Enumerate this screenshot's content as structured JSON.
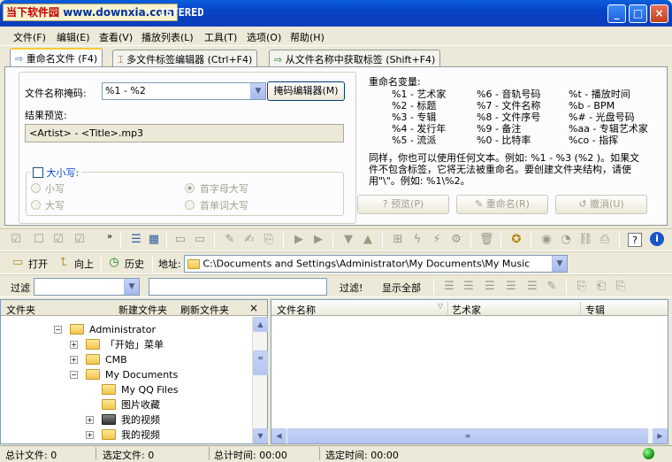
{
  "window": {
    "logo_part1": "当下软件园",
    "logo_part2": "www.downxia.com",
    "title": "ISTERED",
    "min": "_",
    "max": "□",
    "close": "×"
  },
  "menu": [
    "文件(F)",
    "编辑(E)",
    "查看(V)",
    "播放列表(L)",
    "工具(T)",
    "选项(O)",
    "帮助(H)"
  ],
  "tabs": [
    {
      "label": "重命名文件 (F4)"
    },
    {
      "label": "多文件标签编辑器 (Ctrl+F4)"
    },
    {
      "label": "从文件名称中获取标签 (Shift+F4)"
    }
  ],
  "rename": {
    "mask_label": "文件名称掩码:",
    "mask_value": "%1 - %2",
    "mask_editor_btn": "掩码编辑器(M)",
    "preview_label": "结果预览:",
    "preview_value": "<Artist> - <Title>.mp3",
    "case_label": "大小写:",
    "case_options": [
      "小写",
      "大写",
      "首字母大写",
      "首单词大写"
    ],
    "vars_title": "重命名变量:",
    "vars_col1": [
      "%1 - 艺术家",
      "%2 - 标题",
      "%3 - 专辑",
      "%4 - 发行年",
      "%5 - 流派"
    ],
    "vars_col2": [
      "%6 - 音轨号码",
      "%7 - 文件名称",
      "%8 - 文件序号",
      "%9 - 备注",
      "%0 - 比特率"
    ],
    "vars_col3": [
      "%t - 播放时间",
      "%b - BPM",
      "%# - 光盘号码",
      "%aa - 专辑艺术家",
      "%co - 指挥"
    ],
    "note_lines": [
      "同样，你也可以使用任何文本。例如: %1 - %3 (%2 )。如果文",
      "件不包含标签，它将无法被重命名。要创建文件夹结构，请使",
      "用\"\\\"。例如: %1\\%2。"
    ],
    "preview_btn": "预览(P)",
    "rename_btn": "重命名(R)",
    "undo_btn": "撤消(U)"
  },
  "nav": {
    "open": "打开",
    "up": "向上",
    "history": "历史",
    "address_label": "地址:",
    "address_value": "C:\\Documents and Settings\\Administrator\\My Documents\\My Music"
  },
  "filter": {
    "label": "过滤",
    "apply": "过滤!",
    "show_all": "显示全部"
  },
  "folders": {
    "header": "文件夹",
    "new_folder": "新建文件夹",
    "refresh": "刷新文件夹",
    "close": "×",
    "tree": [
      {
        "label": "Administrator",
        "exp": "−"
      },
      {
        "label": "「开始」菜单",
        "exp": "+"
      },
      {
        "label": "CMB",
        "exp": "+"
      },
      {
        "label": "My Documents",
        "exp": "−"
      },
      {
        "label": "My QQ Files",
        "exp": ""
      },
      {
        "label": "图片收藏",
        "exp": ""
      },
      {
        "label": "我的视频",
        "exp": "+"
      },
      {
        "label": "我的视频",
        "exp": "+"
      }
    ]
  },
  "files": {
    "columns": [
      "文件名称",
      "艺术家",
      "专辑"
    ]
  },
  "status": {
    "total_files": "总计文件: 0",
    "selected_files": "选定文件: 0",
    "total_time": "总计时间: 00:00",
    "selected_time": "选定时间: 00:00"
  }
}
